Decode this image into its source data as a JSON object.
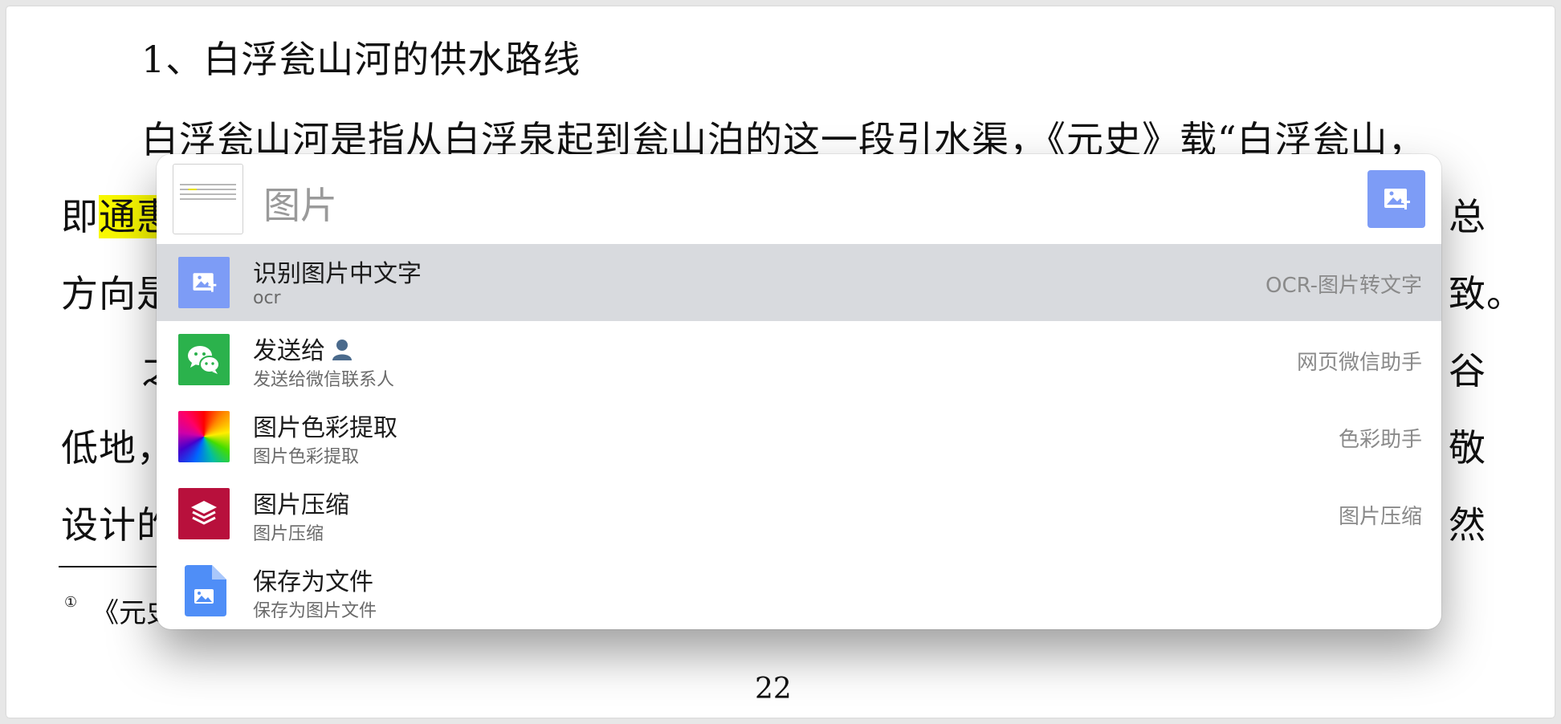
{
  "document": {
    "heading": "1、白浮瓮山河的供水路线",
    "line1": "白浮瓮山河是指从白浮泉起到瓮山泊的这一段引水渠，《元史》载“白浮瓮山，",
    "line2_start": "即",
    "line2_highlight": "通惠",
    "line2_end": "总",
    "line3_start": "方向是",
    "line3_end": "致。",
    "line4_start": "之",
    "line4_end": "谷",
    "line5_start": "低地，",
    "line5_end": "敬",
    "line6_start": "设计的",
    "line6_end": "然",
    "footnote_mark": "①",
    "footnote_text": "《元史",
    "page_number": "22"
  },
  "launcher": {
    "query": "图片",
    "action_icon": "image-ocr-icon",
    "results": [
      {
        "title": "识别图片中文字",
        "subtitle": "ocr",
        "source": "OCR-图片转文字",
        "icon": "image-ocr-icon",
        "color": "#7d9cf6",
        "selected": true
      },
      {
        "title": "发送给",
        "subtitle": "发送给微信联系人",
        "source": "网页微信助手",
        "icon": "wechat-icon",
        "color": "#2bb24c"
      },
      {
        "title": "图片色彩提取",
        "subtitle": "图片色彩提取",
        "source": "色彩助手",
        "icon": "color-wheel-icon",
        "color": "#ff5500"
      },
      {
        "title": "图片压缩",
        "subtitle": "图片压缩",
        "source": "图片压缩",
        "icon": "layers-icon",
        "color": "#b8103c"
      },
      {
        "title": "保存为文件",
        "subtitle": "保存为图片文件",
        "source": "",
        "icon": "image-file-icon",
        "color": "#4f8ef7"
      }
    ]
  }
}
